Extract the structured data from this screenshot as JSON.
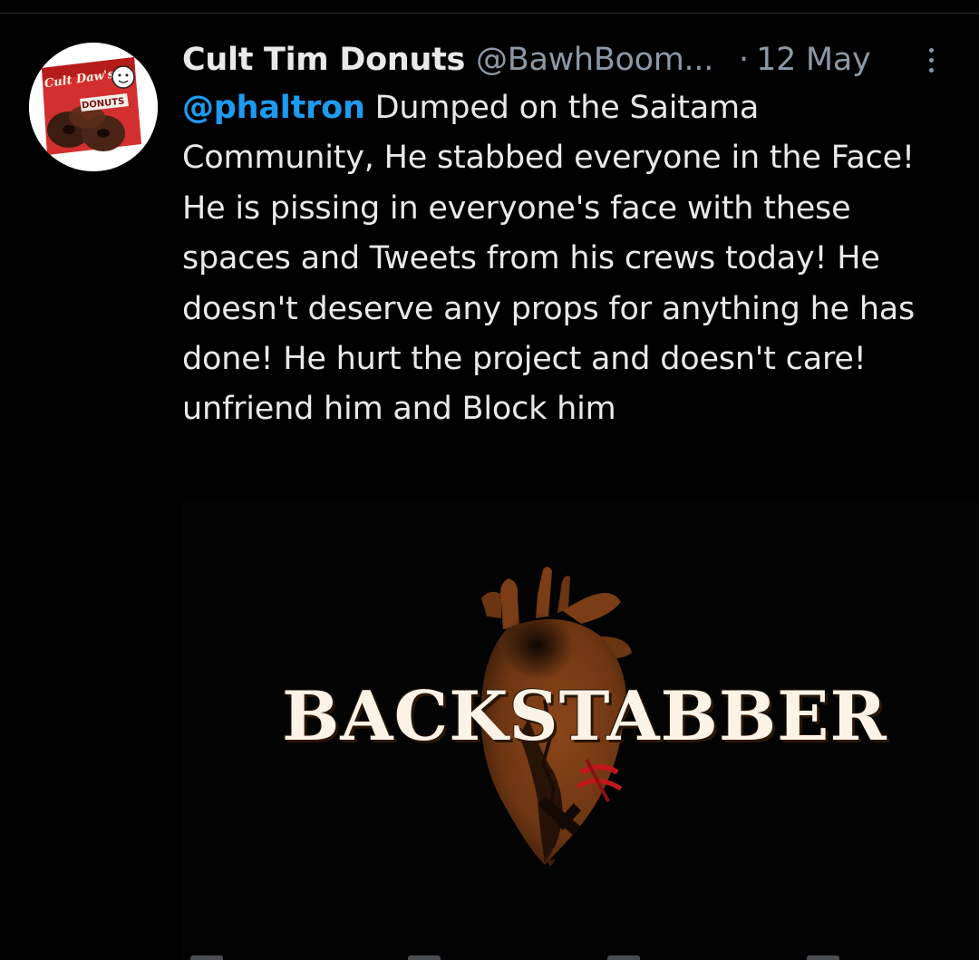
{
  "tweet": {
    "display_name": "Cult Tim Donuts",
    "handle": "@BawhBoom...",
    "separator": "·",
    "date": "12 May",
    "mention": "@phaltron",
    "body": " Dumped on the Saitama Community, He stabbed everyone in the Face! He is pissing in everyone's face with these spaces and Tweets from his crews today! He doesn't deserve any props for anything he has done! He hurt the project and doesn't care! unfriend him and Block him",
    "avatar": {
      "logo_text": "Cult Daw's",
      "product_text": "DONUTS",
      "accent": "#d32f2f"
    },
    "media": {
      "caption": "BACKSTABBER",
      "heart_color": "#7a3d16",
      "wound_color": "#c0171b"
    }
  },
  "colors": {
    "background": "#000000",
    "text": "#e7e9ea",
    "secondary": "#8b98a5",
    "link": "#1d9bf0",
    "divider": "#2f3336"
  }
}
